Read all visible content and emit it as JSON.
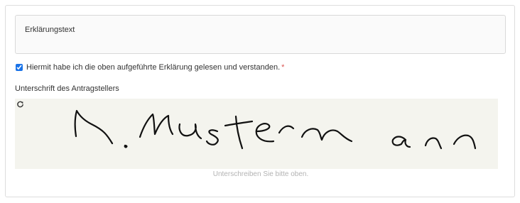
{
  "explanation": {
    "text": "Erklärungstext"
  },
  "consent": {
    "checked": true,
    "label": "Hiermit habe ich die oben aufgeführte Erklärung gelesen und verstanden.",
    "required_marker": "*"
  },
  "signature": {
    "label": "Unterschrift des Antragstellers",
    "reset_icon": "refresh-icon",
    "signed_name": "M. Mustermann",
    "hint": "Unterschreiben Sie bitte oben.",
    "pad_color": "#f4f4ee"
  }
}
